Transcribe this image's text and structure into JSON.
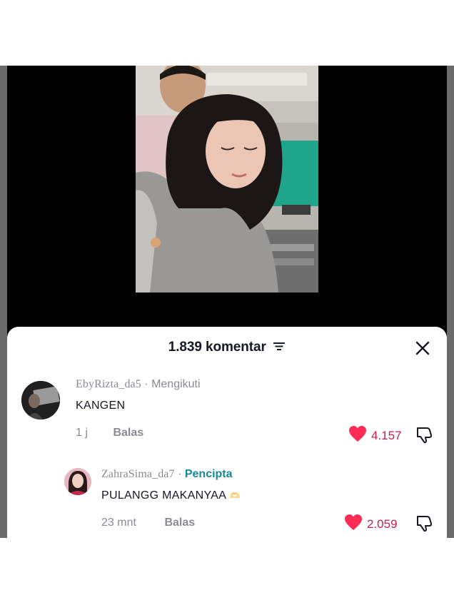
{
  "header": {
    "comment_count": "1.839 komentar"
  },
  "comments": [
    {
      "username": "EbyRizta_da5",
      "separator": "·",
      "status": "Mengikuti",
      "text": "KANGEN",
      "time": "1 j",
      "reply_label": "Balas",
      "likes": "4.157"
    },
    {
      "username": "ZahraSima_da7",
      "separator": "·",
      "status": "Pencipta",
      "text": "PULANGG MAKANYAA",
      "emoji": "🫶",
      "time": "23 mnt",
      "reply_label": "Balas",
      "likes": "2.059"
    }
  ],
  "icons": {
    "filter": "filter-icon",
    "close": "close-icon",
    "like": "heart-icon",
    "dislike": "thumbs-down-icon"
  },
  "colors": {
    "like": "#fe2c55",
    "creator": "#16889a",
    "muted": "#8a8b91",
    "text": "#161823"
  }
}
